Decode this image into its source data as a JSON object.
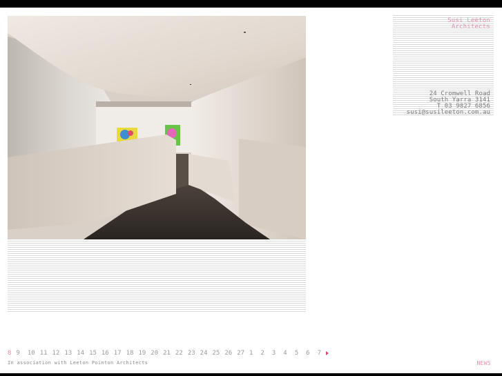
{
  "colors": {
    "accent_pink": "#e890a8",
    "arrow_red": "#d9486b",
    "text_gray": "#7a7a7a",
    "bar_black": "#000000"
  },
  "firm": {
    "line1": "Susi Leeton",
    "line2": "Architects"
  },
  "address": {
    "street": "24 Cromwell Road",
    "suburb": "South Yarra 3141",
    "phone": "T 03 9827 6856",
    "email": "susi@susileeton.com.au"
  },
  "pager": {
    "active": "8",
    "pages": [
      "8",
      "9",
      "10",
      "11",
      "12",
      "13",
      "14",
      "15",
      "16",
      "17",
      "18",
      "19",
      "20",
      "21",
      "22",
      "23",
      "24",
      "25",
      "26",
      "27",
      "1",
      "2",
      "3",
      "4",
      "5",
      "6",
      "7"
    ],
    "next_icon": "triangle-right-icon"
  },
  "footer": {
    "association": "In association with Leeton Pointon Architects",
    "news": "NEWS"
  }
}
